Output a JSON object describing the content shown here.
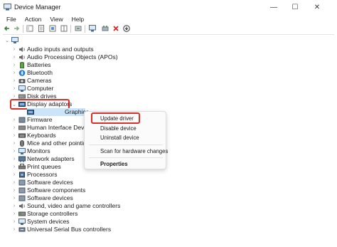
{
  "window": {
    "title": "Device Manager"
  },
  "controls": {
    "minimize": "—",
    "maximize": "☐",
    "close": "✕"
  },
  "menu": [
    "File",
    "Action",
    "View",
    "Help"
  ],
  "tree": {
    "top_items_before": [
      {
        "label": "Audio inputs and outputs",
        "icon": "speaker-icon"
      },
      {
        "label": "Audio Processing Objects (APOs)",
        "icon": "speaker-icon"
      },
      {
        "label": "Batteries",
        "icon": "battery-icon"
      },
      {
        "label": "Bluetooth",
        "icon": "bluetooth-icon"
      },
      {
        "label": "Cameras",
        "icon": "camera-icon"
      },
      {
        "label": "Computer",
        "icon": "monitor-icon"
      },
      {
        "label": "Disk drives",
        "icon": "disk-icon"
      }
    ],
    "expanded": {
      "label": "Display adaptors",
      "child": "Graphics"
    },
    "items_after": [
      "Firmware",
      "Human Interface Devices",
      "Keyboards",
      "Mice and other pointing",
      "Monitors",
      "Network adapters",
      "Print queues",
      "Processors",
      "Software devices",
      "Software components",
      "Software devices",
      "Sound, video and game controllers",
      "Storage controllers",
      "System devices",
      "Universal Serial Bus controllers"
    ]
  },
  "context_menu": {
    "update": "Update driver",
    "disable": "Disable device",
    "uninstall": "Uninstall device",
    "scan": "Scan for hardware changes",
    "properties": "Properties"
  },
  "colors": {
    "highlight": "#d9302c",
    "selection": "#cce4f7"
  }
}
